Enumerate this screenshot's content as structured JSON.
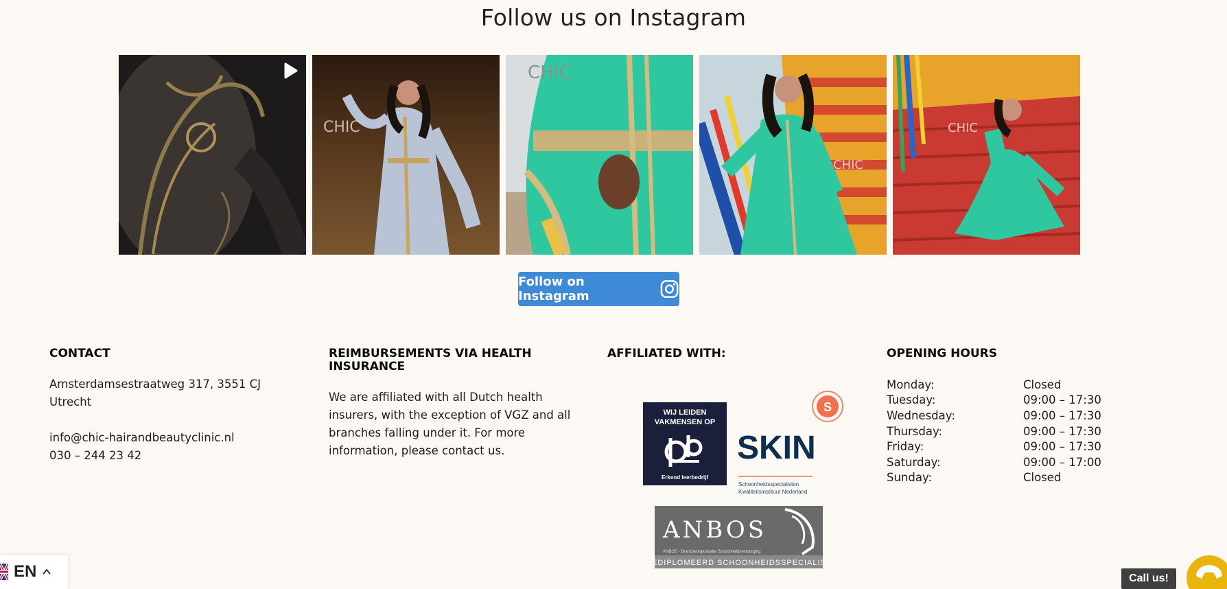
{
  "instagram": {
    "title": "Follow us on Instagram",
    "follow_button": "Follow on Instagram",
    "posts": [
      {
        "type": "video",
        "watermark": ""
      },
      {
        "type": "image",
        "watermark": "CHIC"
      },
      {
        "type": "image",
        "watermark": "CHIC"
      },
      {
        "type": "image",
        "watermark": "CHIC"
      },
      {
        "type": "image",
        "watermark": "CHIC"
      }
    ]
  },
  "footer": {
    "contact": {
      "heading": "CONTACT",
      "address_line1": "Amsterdamsestraatweg 317, 3551 CJ",
      "address_line2": "Utrecht",
      "email": "info@chic-hairandbeautyclinic.nl",
      "phone": "030 – 244 23 42"
    },
    "reimbursements": {
      "heading": "REIMBURSEMENTS VIA HEALTH INSURANCE",
      "text": "We are affiliated with all Dutch health insurers, with the exception of VGZ and all branches falling under it. For more information, please contact us."
    },
    "affiliated": {
      "heading": "AFFILIATED WITH:",
      "logos": [
        {
          "name": "wij-leiden-vakmensen-op",
          "line1": "WIJ LEIDEN",
          "line2": "VAKMENSEN OP",
          "caption": "Erkend leerbedrijf"
        },
        {
          "name": "skin",
          "text": "SKIN",
          "badge": "S",
          "sub1": "Schoonheidsspecialisten",
          "sub2": "Kwaliteitsinstituut Nederland"
        },
        {
          "name": "anbos",
          "text": "ANBOS",
          "sub": "ANBOS - Brancheorganisatie Schoonheidsverzorging",
          "strip": "GEDIPLOMEERD SCHOONHEIDSSPECIALIST"
        }
      ]
    },
    "opening_hours": {
      "heading": "OPENING HOURS",
      "rows": [
        {
          "day": "Monday:",
          "time": "Closed"
        },
        {
          "day": "Tuesday:",
          "time": "09:00 – 17:30"
        },
        {
          "day": "Wednesday:",
          "time": "09:00 – 17:30"
        },
        {
          "day": "Thursday:",
          "time": "09:00 – 17:30"
        },
        {
          "day": "Friday:",
          "time": "09:00 – 17:30"
        },
        {
          "day": "Saturday:",
          "time": "09:00 – 17:00"
        },
        {
          "day": "Sunday:",
          "time": "Closed"
        }
      ]
    }
  },
  "widgets": {
    "language": "EN",
    "call_label": "Call us!"
  },
  "colors": {
    "background": "#fcf8f3",
    "button_blue": "#3f8ad6",
    "call_yellow": "#e9b40b",
    "dress_teal": "#2fc7a0"
  }
}
